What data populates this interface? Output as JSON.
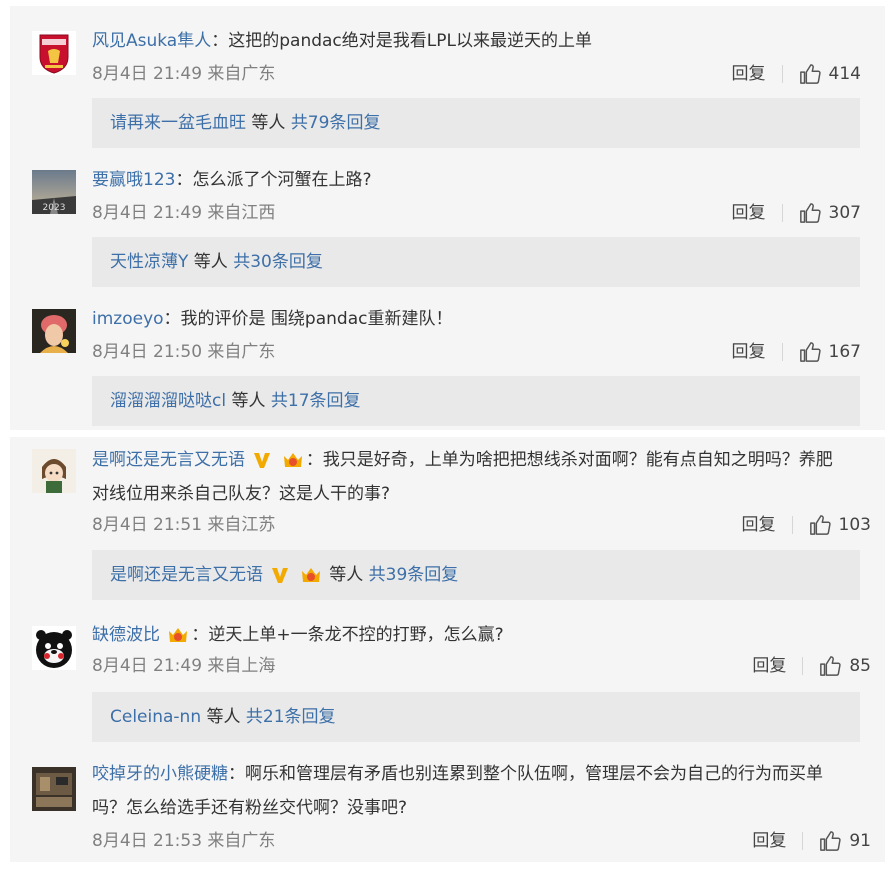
{
  "comments": [
    {
      "user": "风见Asuka隼人",
      "text": "：这把的pandac绝对是我看LPL以来最逆天的上单",
      "time": "8月4日 21:49 来自广东",
      "reply": "回复",
      "likes": "414",
      "sub_user": "请再来一盆毛血旺",
      "sub_mid": " 等人 ",
      "sub_count": "共79条回复"
    },
    {
      "user": "要赢哦123",
      "text": "：怎么派了个河蟹在上路?",
      "time": "8月4日 21:49 来自江西",
      "reply": "回复",
      "likes": "307",
      "sub_user": "天性凉薄Y",
      "sub_mid": " 等人 ",
      "sub_count": "共30条回复"
    },
    {
      "user": "imzoeyo",
      "text": "：我的评价是 围绕pandac重新建队！",
      "time": "8月4日 21:50 来自广东",
      "reply": "回复",
      "likes": "167",
      "sub_user": "溜溜溜溜哒哒cl",
      "sub_mid": " 等人 ",
      "sub_count": "共17条回复"
    },
    {
      "user": "是啊还是无言又无语",
      "text": "：我只是好奇，上单为啥把把想线杀对面啊？能有点自知之明吗？养肥",
      "text2": "对线位用来杀自己队友？这是人干的事?",
      "time": "8月4日 21:51 来自江苏",
      "reply": "回复",
      "likes": "103",
      "sub_user": "是啊还是无言又无语",
      "sub_mid": " 等人 ",
      "sub_count": "共39条回复"
    },
    {
      "user": "缺德波比",
      "text": "：逆天上单+一条龙不控的打野，怎么赢?",
      "time": "8月4日 21:49 来自上海",
      "reply": "回复",
      "likes": "85",
      "sub_user": "Celeina-nn",
      "sub_mid": " 等人 ",
      "sub_count": "共21条回复"
    },
    {
      "user": "咬掉牙的小熊硬糖",
      "text": "：啊乐和管理层有矛盾也别连累到整个队伍啊，管理层不会为自己的行为而买单",
      "text2": "吗？怎么给选手还有粉丝交代啊？没事吧?",
      "time": "8月4日 21:53 来自广东",
      "reply": "回复",
      "likes": "91"
    }
  ],
  "colors": {
    "link": "#3d6fa8",
    "meta": "#808080",
    "panel": "#f5f5f5",
    "reply_box": "#e9e9e9",
    "vip": "#f2a900",
    "badge": "#e8502b"
  },
  "icons": {
    "like": "thumbs-up-icon",
    "vip": "vip-v-icon",
    "member": "crown-badge-icon"
  }
}
